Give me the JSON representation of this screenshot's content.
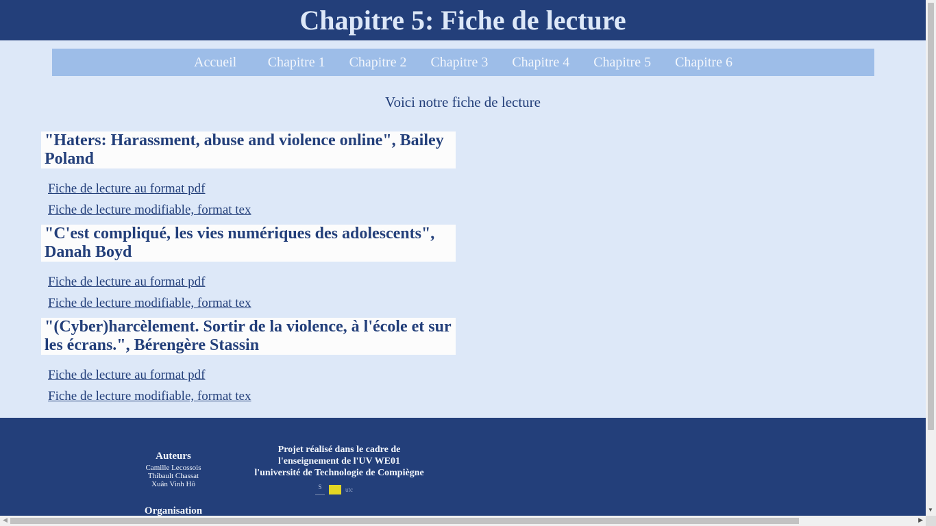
{
  "header": {
    "title": "Chapitre 5: Fiche de lecture"
  },
  "nav": {
    "items": [
      {
        "label": "Accueil"
      },
      {
        "label": "Chapitre 1"
      },
      {
        "label": "Chapitre 2"
      },
      {
        "label": "Chapitre 3"
      },
      {
        "label": "Chapitre 4"
      },
      {
        "label": "Chapitre 5"
      },
      {
        "label": "Chapitre 6"
      }
    ]
  },
  "intro": "Voici notre fiche de lecture",
  "books": [
    {
      "title": "\"Haters: Harassment, abuse and violence online\", Bailey Poland",
      "pdf_link": "Fiche de lecture au format pdf",
      "tex_link": "Fiche de lecture modifiable, format tex"
    },
    {
      "title": "\"C'est compliqué, les vies numériques des adolescents\", Danah Boyd",
      "pdf_link": "Fiche de lecture au format pdf",
      "tex_link": "Fiche de lecture modifiable, format tex"
    },
    {
      "title": "\"(Cyber)harcèlement. Sortir de la violence, à l'école et sur les écrans.\", Bérengère Stassin",
      "pdf_link": "Fiche de lecture au format pdf",
      "tex_link": "Fiche de lecture modifiable, format tex"
    }
  ],
  "footer": {
    "authors_title": "Auteurs",
    "authors": [
      "Camille Lecossois",
      "Thibault Chassat",
      "Xuân Vinh Hô"
    ],
    "organisation_title": "Organisation",
    "project_lines": [
      "Projet réalisé dans le cadre de",
      "l'enseignement de l'UV WE01",
      "l'université de Technologie de Compiègne"
    ],
    "logo_s": "S",
    "logo_utc": "utc"
  },
  "colors": {
    "header_bg": "#233f7a",
    "page_bg": "#dde8f8",
    "nav_bg": "#9dbde8",
    "title_box_bg": "#fcfcfc",
    "accent_yellow": "#e3d624"
  }
}
